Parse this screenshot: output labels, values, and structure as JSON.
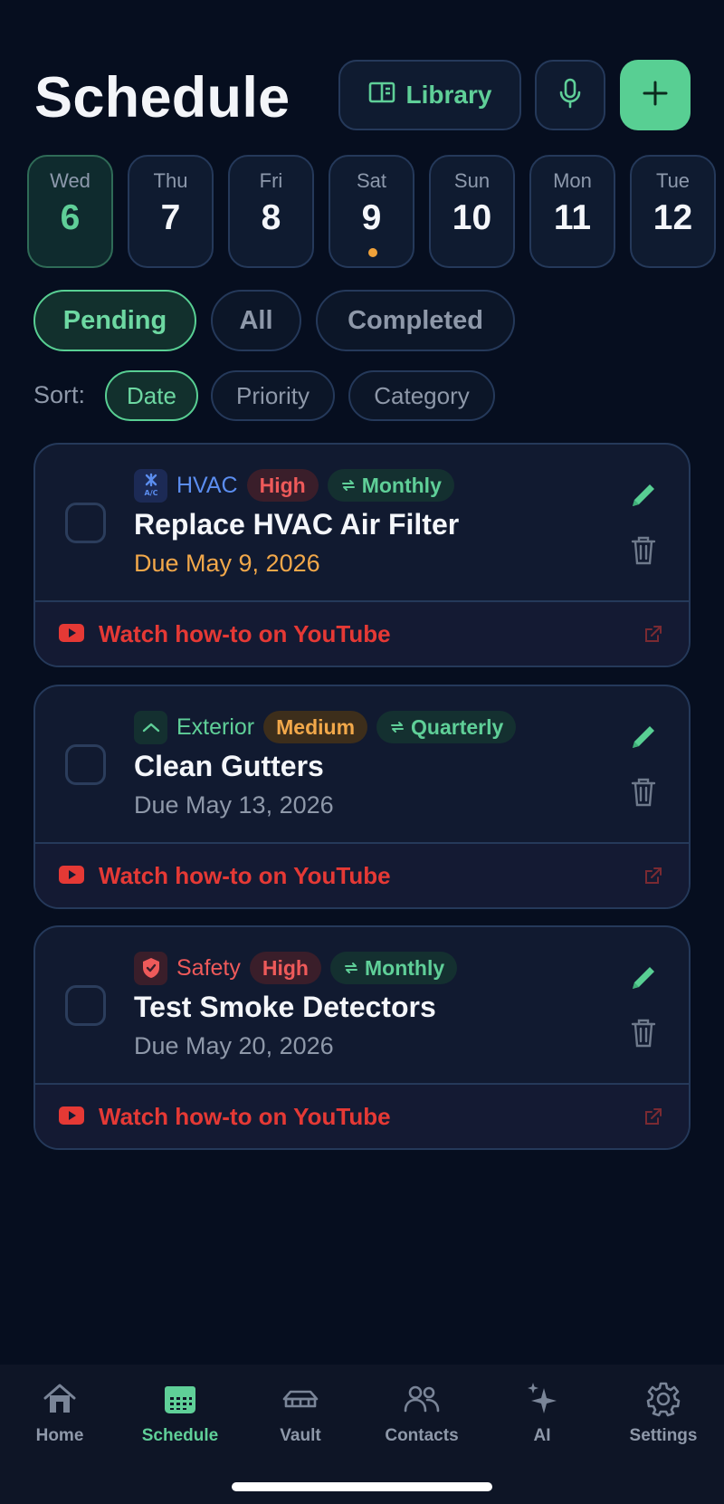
{
  "header": {
    "title": "Schedule",
    "library_label": "Library",
    "mic_icon": "microphone-icon",
    "add_icon": "plus-icon"
  },
  "days": [
    {
      "name": "Wed",
      "num": "6",
      "active": true,
      "has_dot": false
    },
    {
      "name": "Thu",
      "num": "7",
      "active": false,
      "has_dot": false
    },
    {
      "name": "Fri",
      "num": "8",
      "active": false,
      "has_dot": false
    },
    {
      "name": "Sat",
      "num": "9",
      "active": false,
      "has_dot": true
    },
    {
      "name": "Sun",
      "num": "10",
      "active": false,
      "has_dot": false
    },
    {
      "name": "Mon",
      "num": "11",
      "active": false,
      "has_dot": false
    },
    {
      "name": "Tue",
      "num": "12",
      "active": false,
      "has_dot": false
    }
  ],
  "filters": {
    "items": [
      "Pending",
      "All",
      "Completed"
    ],
    "selected": "Pending"
  },
  "sort": {
    "label": "Sort:",
    "items": [
      "Date",
      "Priority",
      "Category"
    ],
    "selected": "Date"
  },
  "tasks": [
    {
      "category": "HVAC",
      "category_color": "#5b8def",
      "category_icon": "ac-icon",
      "icon_text": "A/C",
      "priority": "High",
      "recurrence": "Monthly",
      "title": "Replace HVAC Air Filter",
      "due": "Due May 9, 2026",
      "due_soon": true,
      "video_label": "Watch how-to on YouTube"
    },
    {
      "category": "Exterior",
      "category_color": "#5fcf98",
      "category_icon": "roof-icon",
      "icon_text": "",
      "priority": "Medium",
      "recurrence": "Quarterly",
      "title": "Clean Gutters",
      "due": "Due May 13, 2026",
      "due_soon": false,
      "video_label": "Watch how-to on YouTube"
    },
    {
      "category": "Safety",
      "category_color": "#ee5a5a",
      "category_icon": "shield-icon",
      "icon_text": "",
      "priority": "High",
      "recurrence": "Monthly",
      "title": "Test Smoke Detectors",
      "due": "Due May 20, 2026",
      "due_soon": false,
      "video_label": "Watch how-to on YouTube"
    }
  ],
  "tabbar": {
    "items": [
      {
        "label": "Home",
        "icon": "home-icon"
      },
      {
        "label": "Schedule",
        "icon": "calendar-icon"
      },
      {
        "label": "Vault",
        "icon": "vault-icon"
      },
      {
        "label": "Contacts",
        "icon": "contacts-icon"
      },
      {
        "label": "AI",
        "icon": "sparkle-icon"
      },
      {
        "label": "Settings",
        "icon": "gear-icon"
      }
    ],
    "selected": "Schedule"
  },
  "colors": {
    "accent": "#58cf93",
    "background": "#060e1f",
    "high": "#ee5a5a",
    "medium": "#f2a84a",
    "youtube": "#e53935"
  }
}
